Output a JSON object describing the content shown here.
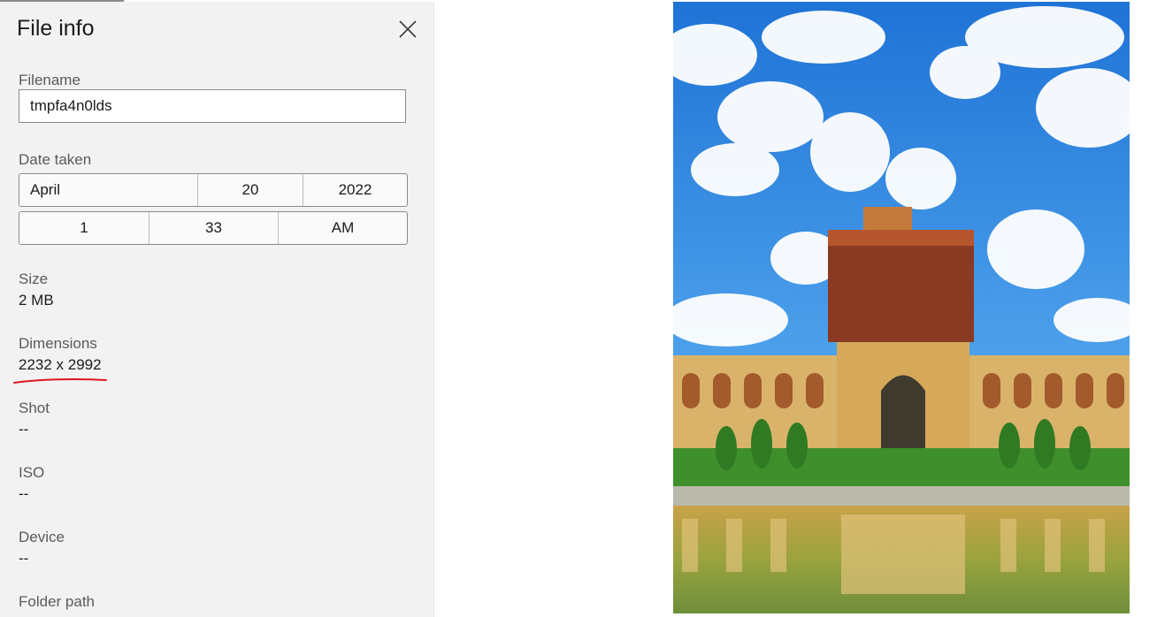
{
  "panel": {
    "title": "File info",
    "close_icon": "close-icon"
  },
  "filename": {
    "label": "Filename",
    "value": "tmpfa4n0lds"
  },
  "date_taken": {
    "label": "Date taken",
    "month": "April",
    "day": "20",
    "year": "2022",
    "hour": "1",
    "minute": "33",
    "ampm": "AM"
  },
  "size": {
    "label": "Size",
    "value": "2 MB"
  },
  "dimensions": {
    "label": "Dimensions",
    "value": "2232 x 2992"
  },
  "shot": {
    "label": "Shot",
    "value": "--"
  },
  "iso": {
    "label": "ISO",
    "value": "--"
  },
  "device": {
    "label": "Device",
    "value": "--"
  },
  "folder_path": {
    "label": "Folder path"
  },
  "colors": {
    "panel_bg": "#f2f2f2",
    "annotation_underline": "#e0141e",
    "sky": "#2f86e0"
  }
}
